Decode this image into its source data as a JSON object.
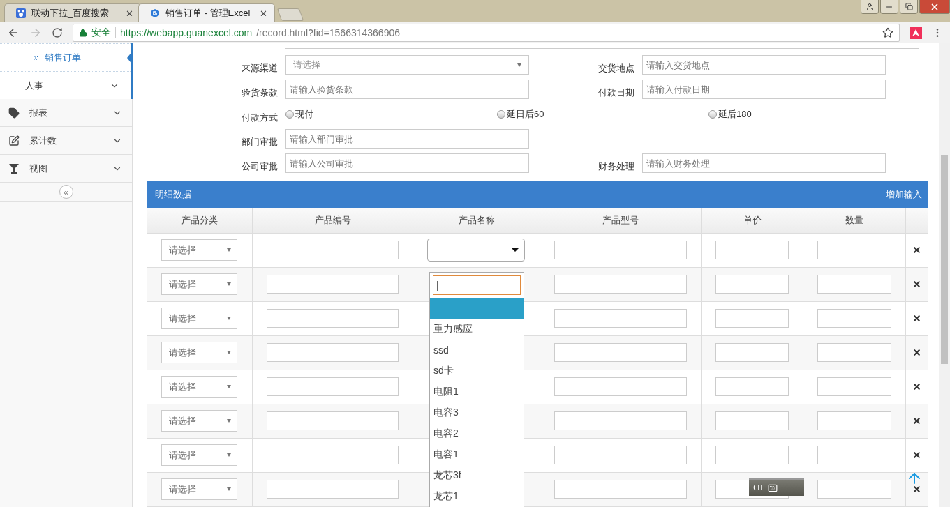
{
  "browser": {
    "tabs": [
      {
        "title": "联动下拉_百度搜索",
        "selected": false,
        "close": "✕"
      },
      {
        "title": "销售订单 - 管理Excel",
        "selected": true,
        "close": "✕"
      }
    ],
    "address": {
      "secure_label": "安全",
      "host": "https://webapp.guanexcel.com",
      "path": "/record.html?fid=1566314366906"
    }
  },
  "sidebar": {
    "sub_items": [
      {
        "label": "销售订单",
        "selected": true,
        "kind": "link"
      },
      {
        "label": "人事",
        "selected": false,
        "kind": "group"
      }
    ],
    "sections": [
      {
        "label": "报表"
      },
      {
        "label": "累计数"
      },
      {
        "label": "视图"
      }
    ],
    "collapse": "«"
  },
  "form": {
    "rows": [
      {
        "left": {
          "label": "来源渠道",
          "kind": "select",
          "placeholder": "请选择"
        },
        "right": {
          "label": "交货地点",
          "kind": "input",
          "placeholder": "请输入交货地点"
        }
      },
      {
        "left": {
          "label": "验货条款",
          "kind": "input",
          "placeholder": "请输入验货条款"
        },
        "right": {
          "label": "付款日期",
          "kind": "input",
          "placeholder": "请输入付款日期"
        }
      },
      {
        "left": {
          "label": "付款方式",
          "kind": "radio",
          "options": [
            {
              "label": "现付",
              "selected": false
            },
            {
              "label": "延日后60",
              "selected": false
            },
            {
              "label": "延后180",
              "selected": false
            }
          ]
        }
      },
      {
        "left": {
          "label": "部门审批",
          "kind": "input",
          "placeholder": "请输入部门审批"
        }
      },
      {
        "left": {
          "label": "公司审批",
          "kind": "input",
          "placeholder": "请输入公司审批"
        },
        "right": {
          "label": "财务处理",
          "kind": "input",
          "placeholder": "请输入财务处理"
        }
      }
    ]
  },
  "detail": {
    "title": "明细数据",
    "add_link": "增加输入",
    "columns": [
      "产品分类",
      "产品编号",
      "产品名称",
      "产品型号",
      "单价",
      "数量"
    ],
    "rows": [
      {
        "category": "请选择",
        "name_open": true
      },
      {
        "category": "请选择"
      },
      {
        "category": "请选择"
      },
      {
        "category": "请选择"
      },
      {
        "category": "请选择"
      },
      {
        "category": "请选择"
      },
      {
        "category": "请选择"
      },
      {
        "category": "请选择"
      }
    ],
    "dropdown": {
      "search_value": "|",
      "options": [
        {
          "selected": true
        },
        {
          "label": "重力感应",
          "selected": false
        },
        {
          "label": "ssd",
          "selected": false
        },
        {
          "label": "sd卡",
          "selected": false
        },
        {
          "label": "电阻1",
          "selected": false
        },
        {
          "label": "电容3",
          "selected": false
        },
        {
          "label": "电容2",
          "selected": false
        },
        {
          "label": "电容1",
          "selected": false
        },
        {
          "label": "龙芯3f",
          "selected": false
        },
        {
          "label": "龙芯1",
          "selected": false
        }
      ]
    }
  },
  "ime_bar": {
    "label": "CH"
  }
}
